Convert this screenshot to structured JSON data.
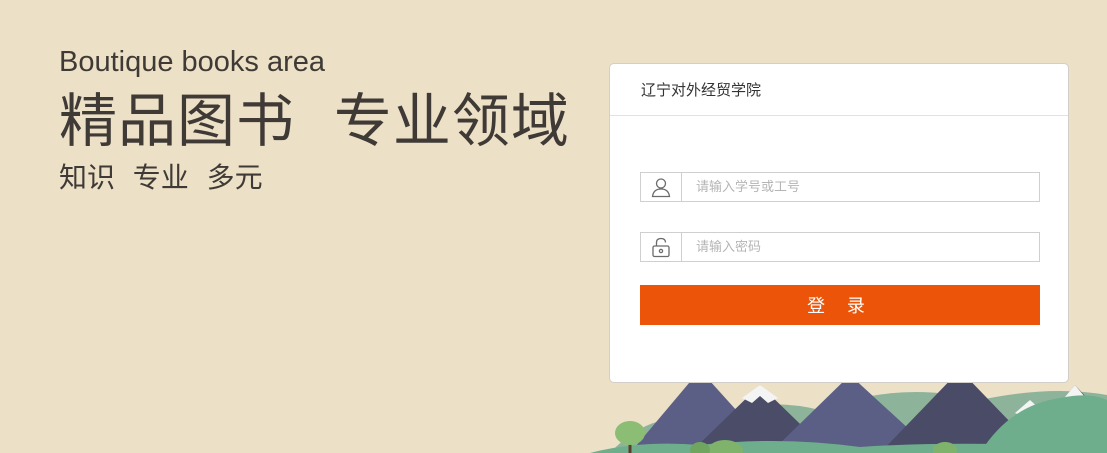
{
  "hero": {
    "english": "Boutique books area",
    "headline": "精品图书  专业领域",
    "subline": "知识  专业  多元"
  },
  "login": {
    "institution": "辽宁对外经贸学院",
    "username_placeholder": "请输入学号或工号",
    "username_value": "",
    "password_placeholder": "请输入密码",
    "password_value": "",
    "submit_label": "登 录",
    "user_icon": "user-icon",
    "lock_icon": "lock-icon"
  },
  "colors": {
    "background": "#ece0c6",
    "accent": "#ec5409",
    "text": "#3f3a36"
  }
}
